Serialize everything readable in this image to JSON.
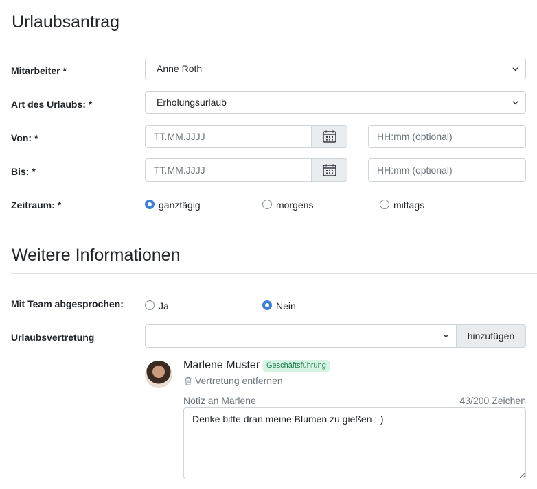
{
  "header": {
    "title": "Urlaubsantrag"
  },
  "form": {
    "employee": {
      "label": "Mitarbeiter *",
      "value": "Anne Roth"
    },
    "type": {
      "label": "Art des Urlaubs: *",
      "value": "Erholungsurlaub"
    },
    "from": {
      "label": "Von: *",
      "date_placeholder": "TT.MM.JJJJ",
      "time_placeholder": "HH:mm (optional)"
    },
    "to": {
      "label": "Bis: *",
      "date_placeholder": "TT.MM.JJJJ",
      "time_placeholder": "HH:mm (optional)"
    },
    "period": {
      "label": "Zeitraum: *",
      "options": [
        "ganztägig",
        "morgens",
        "mittags"
      ],
      "selected": "ganztägig"
    }
  },
  "more": {
    "title": "Weitere Informationen",
    "team": {
      "label": "Mit Team abgesprochen:",
      "options": [
        "Ja",
        "Nein"
      ],
      "selected": "Nein"
    },
    "substitute": {
      "label": "Urlaubsvertretung",
      "select_value": "",
      "add_label": "hinzufügen",
      "person": {
        "name": "Marlene Muster",
        "role_badge": "Geschäftsführung",
        "remove_label": "Vertretung entfernen",
        "note_label": "Notiz an Marlene",
        "note_counter": "43/200 Zeichen",
        "note_text": "Denke bitte dran meine Blumen zu gießen :-)"
      }
    }
  },
  "colors": {
    "accent": "#3d7fd9",
    "badge_bg": "#d4f3e3",
    "badge_text": "#1a7a4c"
  }
}
